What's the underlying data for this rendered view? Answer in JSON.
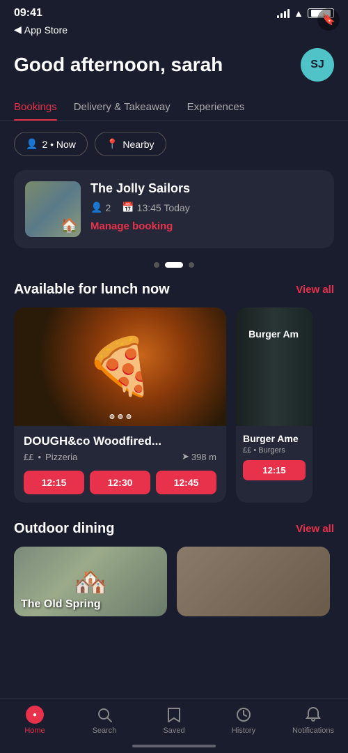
{
  "status": {
    "time": "09:41",
    "back_label": "App Store"
  },
  "header": {
    "greeting": "Good afternoon, sarah",
    "avatar_initials": "SJ"
  },
  "tabs": [
    {
      "id": "bookings",
      "label": "Bookings",
      "active": true
    },
    {
      "id": "delivery",
      "label": "Delivery & Takeaway",
      "active": false
    },
    {
      "id": "experiences",
      "label": "Experiences",
      "active": false
    }
  ],
  "filters": {
    "guests": "2 • Now",
    "location": "Nearby"
  },
  "booking_card": {
    "name": "The Jolly Sailors",
    "guests": "2",
    "time": "13:45 Today",
    "manage_label": "Manage booking"
  },
  "scroll_dots": [
    {
      "active": false
    },
    {
      "active": true
    },
    {
      "active": false
    }
  ],
  "lunch_section": {
    "title": "Available for lunch now",
    "view_all": "View all",
    "restaurants": [
      {
        "name": "DOUGH&co Woodfired...",
        "price": "££",
        "category": "Pizzeria",
        "distance": "398 m",
        "times": [
          "12:15",
          "12:30",
          "12:45"
        ]
      },
      {
        "name": "Burger Ame",
        "price": "££",
        "category": "Burgers",
        "times": [
          "12:15"
        ]
      }
    ]
  },
  "outdoor_section": {
    "title": "Outdoor dining",
    "view_all": "View all",
    "restaurants": [
      {
        "name": "The Old Spring"
      }
    ]
  },
  "bottom_nav": [
    {
      "id": "home",
      "label": "Home",
      "active": true
    },
    {
      "id": "search",
      "label": "Search",
      "active": false
    },
    {
      "id": "saved",
      "label": "Saved",
      "active": false
    },
    {
      "id": "history",
      "label": "History",
      "active": false
    },
    {
      "id": "notifications",
      "label": "Notifications",
      "active": false
    }
  ]
}
